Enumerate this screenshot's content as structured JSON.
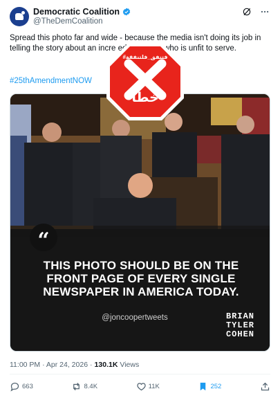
{
  "author": {
    "display_name": "Democratic Coalition",
    "handle": "@TheDemCoalition"
  },
  "tweet": {
    "text": "Spread this photo far and wide - because the media isn't doing its job in telling the story about an incre                  ed president who is unfit to serve.",
    "hashtag": "#25thAmendmentNOW",
    "timestamp": "11:00 PM · Apr 24, 2026",
    "views_count": "130.1K",
    "views_label": "Views"
  },
  "media": {
    "quote_mark": "“",
    "headline": "THIS PHOTO SHOULD BE ON THE FRONT PAGE OF EVERY SINGLE NEWSPAPER IN AMERICA TODAY.",
    "credit": "@joncoopertweets",
    "watermark_lines": [
      "BRIAN",
      "TYLER",
      "COHEN"
    ]
  },
  "stamp": {
    "top_text": "#فتنفق_فلتنفقة",
    "bottom_text": "خطأ",
    "color": "#e8241c"
  },
  "actions": {
    "replies": "663",
    "reposts": "8.4K",
    "likes": "11K",
    "bookmarks": "252"
  },
  "colors": {
    "accent": "#1d9bf0",
    "text_secondary": "#536471",
    "avatar_bg": "#1b3f8f"
  }
}
